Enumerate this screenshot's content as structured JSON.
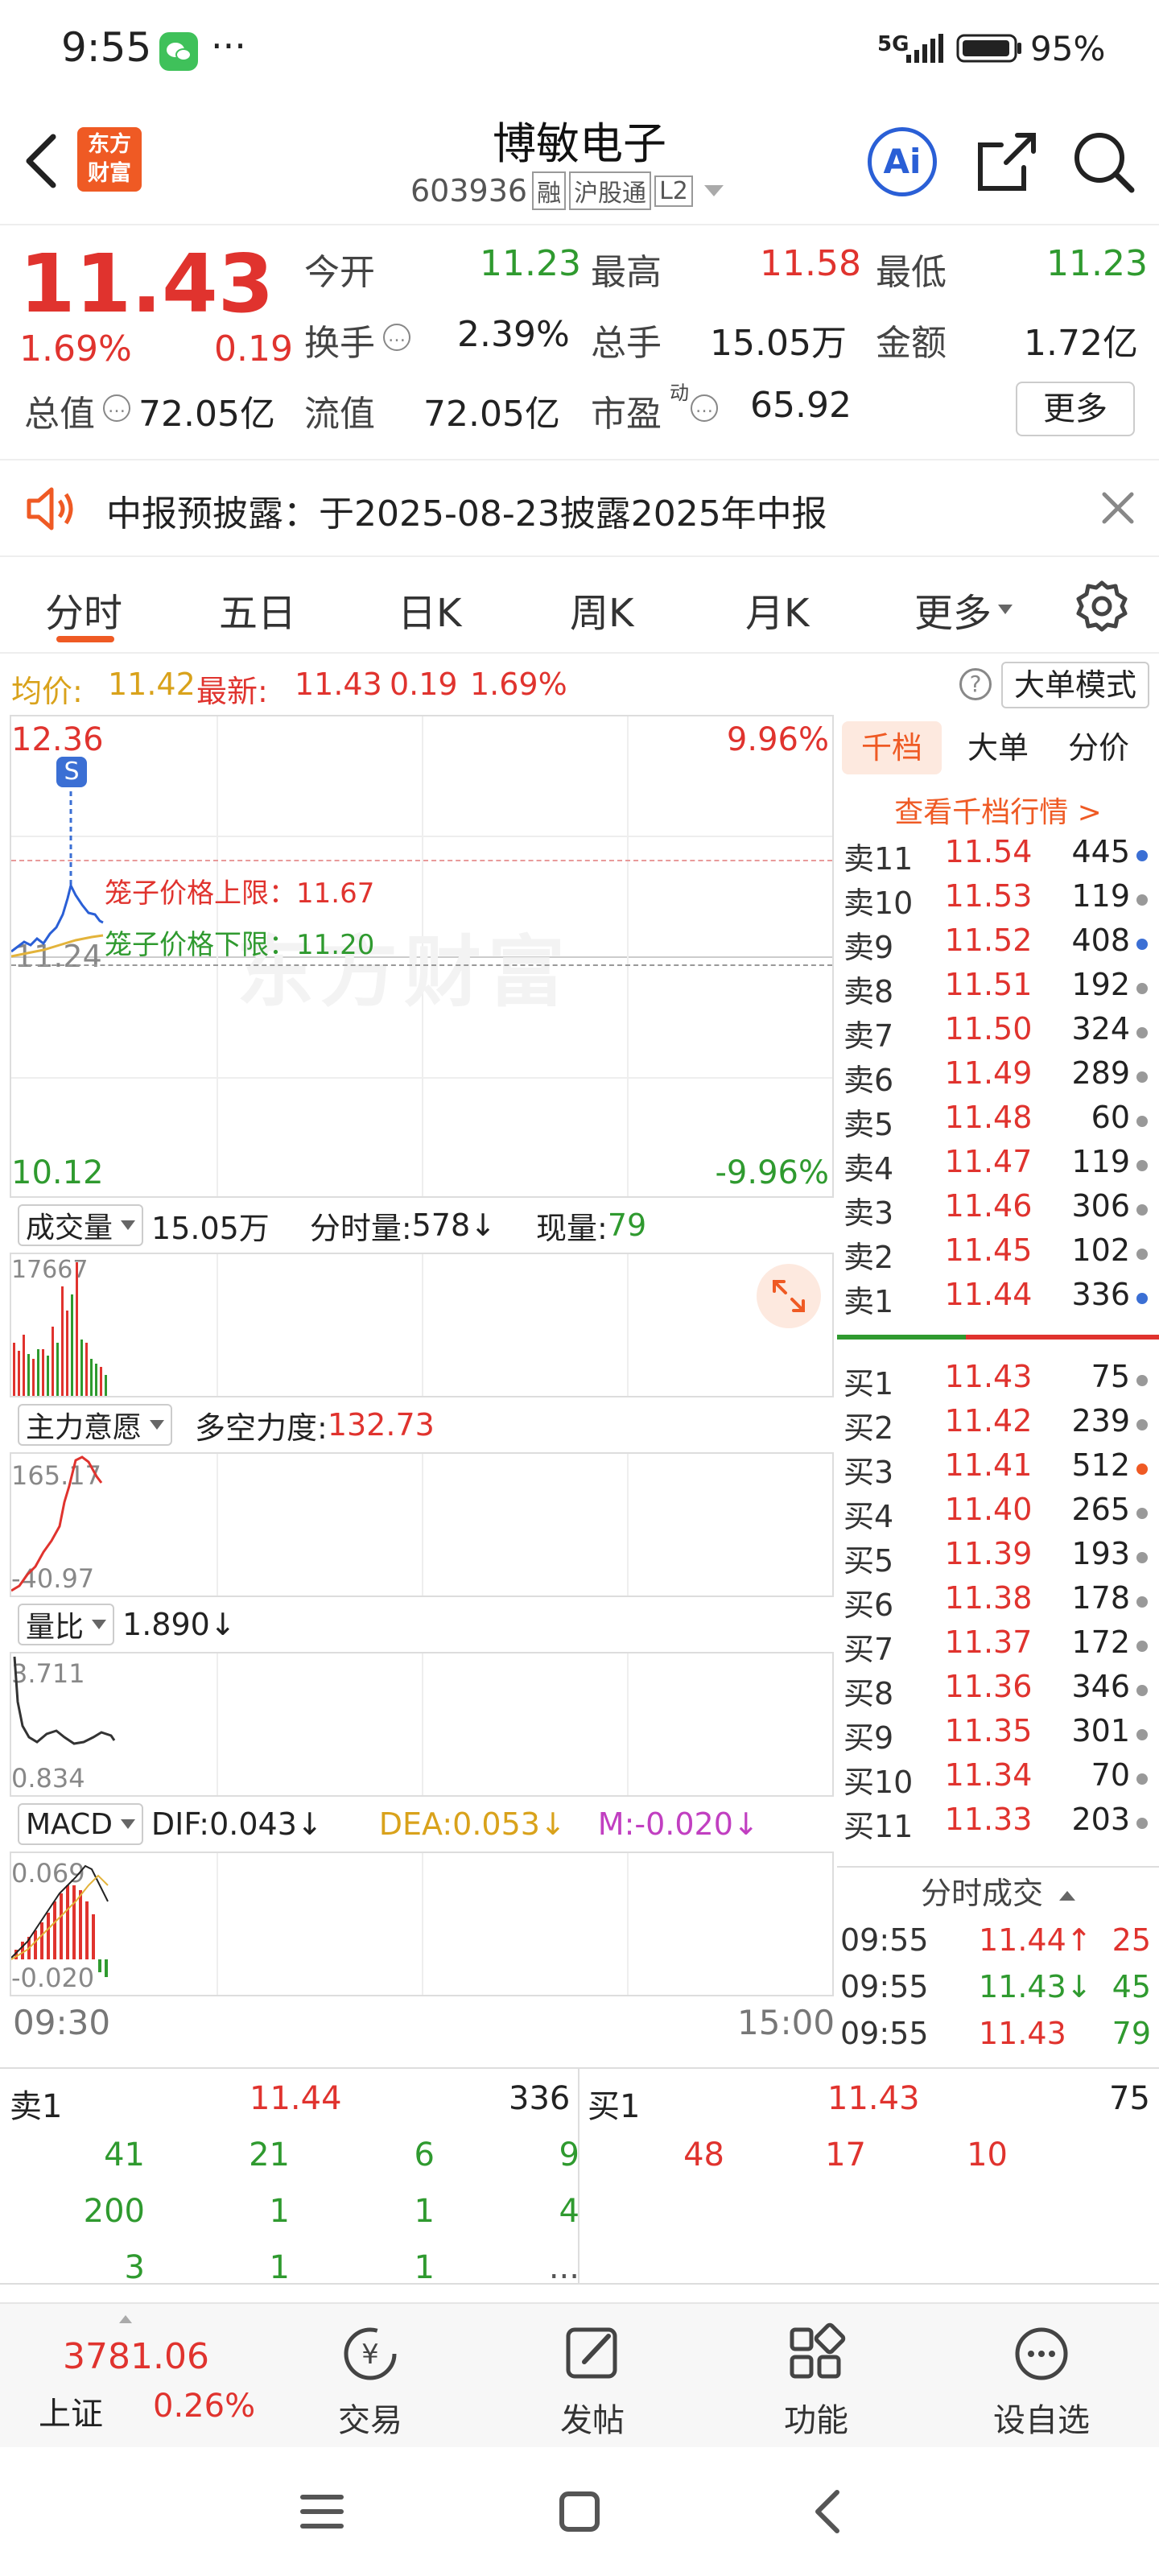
{
  "status_bar": {
    "time": "9:55",
    "dots": "···",
    "network": "5G",
    "battery": "95%"
  },
  "header": {
    "logo_line1": "东方",
    "logo_line2": "财富",
    "name": "博敏电子",
    "code": "603936",
    "tag1": "融",
    "tag2": "沪股通",
    "tag3": "L2",
    "ai_label": "Ai"
  },
  "quote": {
    "price": "11.43",
    "pct": "1.69%",
    "chg": "0.19",
    "open_label": "今开",
    "open": "11.23",
    "high_label": "最高",
    "high": "11.58",
    "low_label": "最低",
    "low": "11.23",
    "turnover_label": "换手",
    "turnover": "2.39%",
    "vol_label": "总手",
    "vol": "15.05万",
    "amt_label": "金额",
    "amt": "1.72亿",
    "mcap_label": "总值",
    "mcap": "72.05亿",
    "float_label": "流值",
    "float": "72.05亿",
    "pe_label": "市盈",
    "pe_sup": "动",
    "pe": "65.92",
    "more": "更多"
  },
  "notice": {
    "text": "中报预披露：于2025-08-23披露2025年中报"
  },
  "tabs": [
    "分时",
    "五日",
    "日K",
    "周K",
    "月K",
    "更多"
  ],
  "avg": {
    "avg_label": "均价:",
    "avg": "11.42",
    "latest_label": "最新:",
    "latest": "11.43",
    "chg": "0.19",
    "pct": "1.69%",
    "mode": "大单模式"
  },
  "price_chart": {
    "top": "12.36",
    "top_pct": "9.96%",
    "bottom": "10.12",
    "bottom_pct": "-9.96%",
    "mid": "11.24",
    "marker": "S",
    "upper_label": "笼子价格上限：11.67",
    "lower_label": "笼子价格下限：11.20",
    "watermark": "东方财富"
  },
  "volume_panel": {
    "selector": "成交量",
    "total": "15.05万",
    "minute_label": "分时量:",
    "minute": "578",
    "now_label": "现量:",
    "now": "79",
    "max": "17667"
  },
  "intent_panel": {
    "selector": "主力意愿",
    "label": "多空力度:",
    "value": "132.73",
    "max": "165.17",
    "min": "-40.97"
  },
  "ratio_panel": {
    "selector": "量比",
    "value": "1.890",
    "max": "3.711",
    "min": "0.834"
  },
  "macd_panel": {
    "selector": "MACD",
    "dif_label": "DIF:",
    "dif": "0.043",
    "dea_label": "DEA:",
    "dea": "0.053",
    "m_label": "M:",
    "m": "-0.020",
    "max": "0.069",
    "min": "-0.020"
  },
  "time_axis": {
    "start": "09:30",
    "end": "15:00"
  },
  "book": {
    "tabs": [
      "千档",
      "大单",
      "分价"
    ],
    "link": "查看千档行情 >",
    "asks": [
      [
        "卖11",
        "11.54",
        "445",
        "#3b6fd4"
      ],
      [
        "卖10",
        "11.53",
        "119",
        "#999"
      ],
      [
        "卖9",
        "11.52",
        "408",
        "#3b6fd4"
      ],
      [
        "卖8",
        "11.51",
        "192",
        "#999"
      ],
      [
        "卖7",
        "11.50",
        "324",
        "#999"
      ],
      [
        "卖6",
        "11.49",
        "289",
        "#999"
      ],
      [
        "卖5",
        "11.48",
        "60",
        "#999"
      ],
      [
        "卖4",
        "11.47",
        "119",
        "#999"
      ],
      [
        "卖3",
        "11.46",
        "306",
        "#999"
      ],
      [
        "卖2",
        "11.45",
        "102",
        "#999"
      ],
      [
        "卖1",
        "11.44",
        "336",
        "#3b6fd4"
      ]
    ],
    "bids": [
      [
        "买1",
        "11.43",
        "75",
        "#999"
      ],
      [
        "买2",
        "11.42",
        "239",
        "#999"
      ],
      [
        "买3",
        "11.41",
        "512",
        "#ef5a24"
      ],
      [
        "买4",
        "11.40",
        "265",
        "#999"
      ],
      [
        "买5",
        "11.39",
        "193",
        "#999"
      ],
      [
        "买6",
        "11.38",
        "178",
        "#999"
      ],
      [
        "买7",
        "11.37",
        "172",
        "#999"
      ],
      [
        "买8",
        "11.36",
        "346",
        "#999"
      ],
      [
        "买9",
        "11.35",
        "301",
        "#999"
      ],
      [
        "买10",
        "11.34",
        "70",
        "#999"
      ],
      [
        "买11",
        "11.33",
        "203",
        "#999"
      ]
    ],
    "trades_title": "分时成交",
    "trades": [
      [
        "09:55",
        "11.44↑",
        "25"
      ],
      [
        "09:55",
        "11.43↓",
        "45"
      ],
      [
        "09:55",
        "11.43",
        "79"
      ]
    ]
  },
  "queue": {
    "sell_label": "卖1",
    "sell_price": "11.44",
    "sell_total": "336",
    "buy_label": "买1",
    "buy_price": "11.43",
    "buy_total": "75",
    "sell_rows": [
      [
        "41",
        "21",
        "6",
        "9"
      ],
      [
        "200",
        "1",
        "1",
        "4"
      ],
      [
        "3",
        "1",
        "1",
        "..."
      ]
    ],
    "buy_rows": [
      [
        "48",
        "17",
        "10"
      ]
    ]
  },
  "bottom": {
    "index_value": "3781.06",
    "index_name": "上证",
    "index_pct": "0.26%",
    "nav": [
      "交易",
      "发帖",
      "功能",
      "设自选"
    ]
  }
}
